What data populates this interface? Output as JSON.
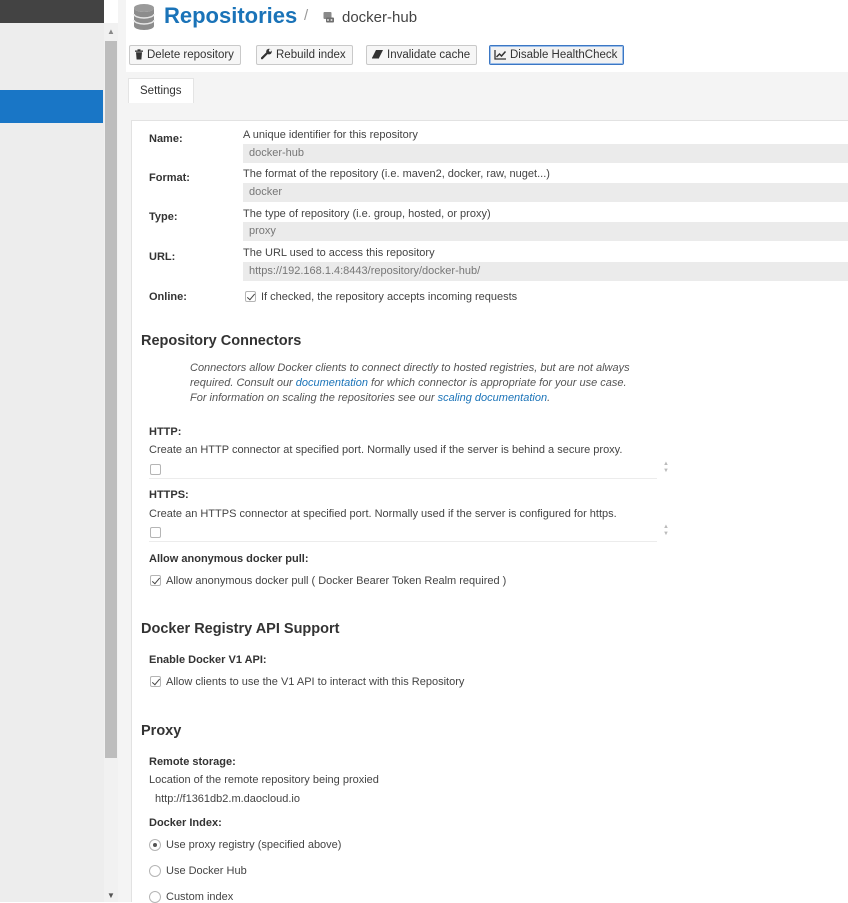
{
  "breadcrumb": {
    "title": "Repositories",
    "separator": "/",
    "current": "docker-hub"
  },
  "toolbar": {
    "delete_label": "Delete repository",
    "rebuild_label": "Rebuild index",
    "invalidate_label": "Invalidate cache",
    "healthcheck_label": "Disable HealthCheck"
  },
  "tabs": {
    "settings": "Settings"
  },
  "fields": {
    "name": {
      "label": "Name:",
      "help": "A unique identifier for this repository",
      "value": "docker-hub"
    },
    "format": {
      "label": "Format:",
      "help": "The format of the repository (i.e. maven2, docker, raw, nuget...)",
      "value": "docker"
    },
    "type": {
      "label": "Type:",
      "help": "The type of repository (i.e. group, hosted, or proxy)",
      "value": "proxy"
    },
    "url": {
      "label": "URL:",
      "help": "The URL used to access this repository",
      "value": "https://192.168.1.4:8443/repository/docker-hub/"
    },
    "online": {
      "label": "Online:",
      "checkbox_text": "If checked, the repository accepts incoming requests",
      "checked": true
    }
  },
  "connectors": {
    "heading": "Repository Connectors",
    "note_1": "Connectors allow Docker clients to connect directly to hosted registries, but are not always required. Consult our ",
    "note_link_1": "documentation",
    "note_2": " for which connector is appropriate for your use case. For information on scaling the repositories see our ",
    "note_link_2": "scaling documentation",
    "note_3": ".",
    "http": {
      "label": "HTTP:",
      "desc": "Create an HTTP connector at specified port. Normally used if the server is behind a secure proxy.",
      "checked": false
    },
    "https": {
      "label": "HTTPS:",
      "desc": "Create an HTTPS connector at specified port. Normally used if the server is configured for https.",
      "checked": false
    },
    "anonymous": {
      "label": "Allow anonymous docker pull:",
      "checkbox_text": "Allow anonymous docker pull ( Docker Bearer Token Realm required )",
      "checked": true
    }
  },
  "registry_api": {
    "heading": "Docker Registry API Support",
    "v1": {
      "label": "Enable Docker V1 API:",
      "checkbox_text": "Allow clients to use the V1 API to interact with this Repository",
      "checked": true
    }
  },
  "proxy": {
    "heading": "Proxy",
    "remote_storage": {
      "label": "Remote storage:",
      "desc": "Location of the remote repository being proxied",
      "value": "http://f1361db2.m.daocloud.io"
    },
    "docker_index": {
      "label": "Docker Index:",
      "options": [
        "Use proxy registry (specified above)",
        "Use Docker Hub",
        "Custom index"
      ],
      "selected": "Use proxy registry (specified above)"
    }
  },
  "icons": {
    "header": "database-icon",
    "crumb": "docker-repo-icon",
    "delete": "trash-icon",
    "rebuild": "wrench-icon",
    "invalidate": "eraser-icon",
    "healthcheck": "line-chart-icon"
  },
  "colors": {
    "accent": "#1a73b8",
    "sidebar_selected": "#1976c6",
    "sidebar_top": "#434343"
  }
}
